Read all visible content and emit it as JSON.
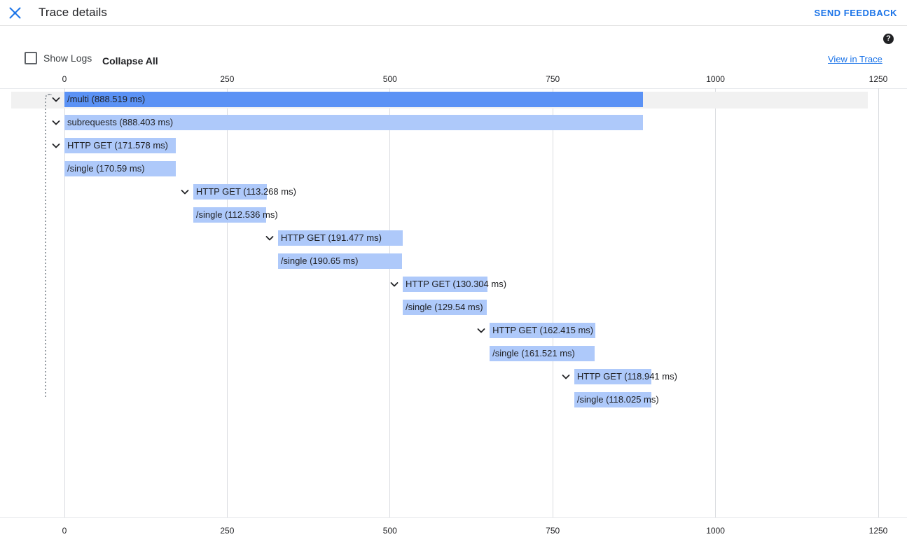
{
  "topbar": {
    "close_icon": "close-icon",
    "title": "Trace details",
    "send_feedback": "SEND FEEDBACK"
  },
  "toolbar": {
    "show_logs_label": "Show Logs",
    "show_logs_checked": false,
    "collapse_all_label": "Collapse All",
    "view_in_trace_label": "View in Trace",
    "help_icon_glyph": "?"
  },
  "chart_data": {
    "type": "bar",
    "title": "Trace details",
    "xlabel": "",
    "ylabel": "",
    "xlim": [
      0,
      1250
    ],
    "axis_unit": "ms",
    "grid": true,
    "legend": null,
    "tick_labels": [
      "0",
      "250",
      "500",
      "750",
      "1000",
      "1250"
    ],
    "tick_values": [
      0,
      250,
      500,
      750,
      1000,
      1250
    ],
    "axis_top_labels": [
      "0",
      "250",
      "500",
      "750",
      "1000",
      "1250"
    ],
    "axis_bottom_labels": [
      "0",
      "250",
      "500",
      "750",
      "1000",
      "1250"
    ],
    "spans": [
      {
        "label": "/multi (888.519 ms)",
        "name": "/multi",
        "duration_ms": 888.519,
        "start_ms": 0,
        "depth": 0,
        "expandable": true,
        "root": true,
        "selected": true
      },
      {
        "label": "subrequests (888.403 ms)",
        "name": "subrequests",
        "duration_ms": 888.403,
        "start_ms": 0,
        "depth": 0,
        "expandable": true,
        "root": false,
        "selected": false
      },
      {
        "label": "HTTP GET (171.578 ms)",
        "name": "HTTP GET",
        "duration_ms": 171.578,
        "start_ms": 0,
        "depth": 0,
        "expandable": true,
        "root": false,
        "selected": false
      },
      {
        "label": "/single (170.59 ms)",
        "name": "/single",
        "duration_ms": 170.59,
        "start_ms": 0,
        "depth": 1,
        "expandable": false,
        "root": false,
        "selected": false
      },
      {
        "label": "HTTP GET (113.268 ms)",
        "name": "HTTP GET",
        "duration_ms": 113.268,
        "start_ms": 197.8,
        "depth": 1,
        "expandable": true,
        "root": false,
        "selected": false
      },
      {
        "label": "/single (112.536 ms)",
        "name": "/single",
        "duration_ms": 112.536,
        "start_ms": 197.8,
        "depth": 2,
        "expandable": false,
        "root": false,
        "selected": false
      },
      {
        "label": "HTTP GET (191.477 ms)",
        "name": "HTTP GET",
        "duration_ms": 191.477,
        "start_ms": 328.0,
        "depth": 2,
        "expandable": true,
        "root": false,
        "selected": false
      },
      {
        "label": "/single (190.65 ms)",
        "name": "/single",
        "duration_ms": 190.65,
        "start_ms": 328.0,
        "depth": 3,
        "expandable": false,
        "root": false,
        "selected": false
      },
      {
        "label": "HTTP GET (130.304 ms)",
        "name": "HTTP GET",
        "duration_ms": 130.304,
        "start_ms": 519.6,
        "depth": 3,
        "expandable": true,
        "root": false,
        "selected": false
      },
      {
        "label": "/single (129.54 ms)",
        "name": "/single",
        "duration_ms": 129.54,
        "start_ms": 519.6,
        "depth": 4,
        "expandable": false,
        "root": false,
        "selected": false
      },
      {
        "label": "HTTP GET (162.415 ms)",
        "name": "HTTP GET",
        "duration_ms": 162.415,
        "start_ms": 653.1,
        "depth": 4,
        "expandable": true,
        "root": false,
        "selected": false
      },
      {
        "label": "/single (161.521 ms)",
        "name": "/single",
        "duration_ms": 161.521,
        "start_ms": 653.1,
        "depth": 5,
        "expandable": false,
        "root": false,
        "selected": false
      },
      {
        "label": "HTTP GET (118.941 ms)",
        "name": "HTTP GET",
        "duration_ms": 118.941,
        "start_ms": 783.0,
        "depth": 5,
        "expandable": true,
        "root": false,
        "selected": false
      },
      {
        "label": "/single (118.025 ms)",
        "name": "/single",
        "duration_ms": 118.025,
        "start_ms": 783.0,
        "depth": 6,
        "expandable": false,
        "root": false,
        "selected": false
      }
    ]
  },
  "colors": {
    "root_bar": "#5b92f5",
    "child_bar": "#aec9fa",
    "accent": "#1a73e8",
    "grid": "#dadce0",
    "row_highlight": "#f1f1f1"
  }
}
